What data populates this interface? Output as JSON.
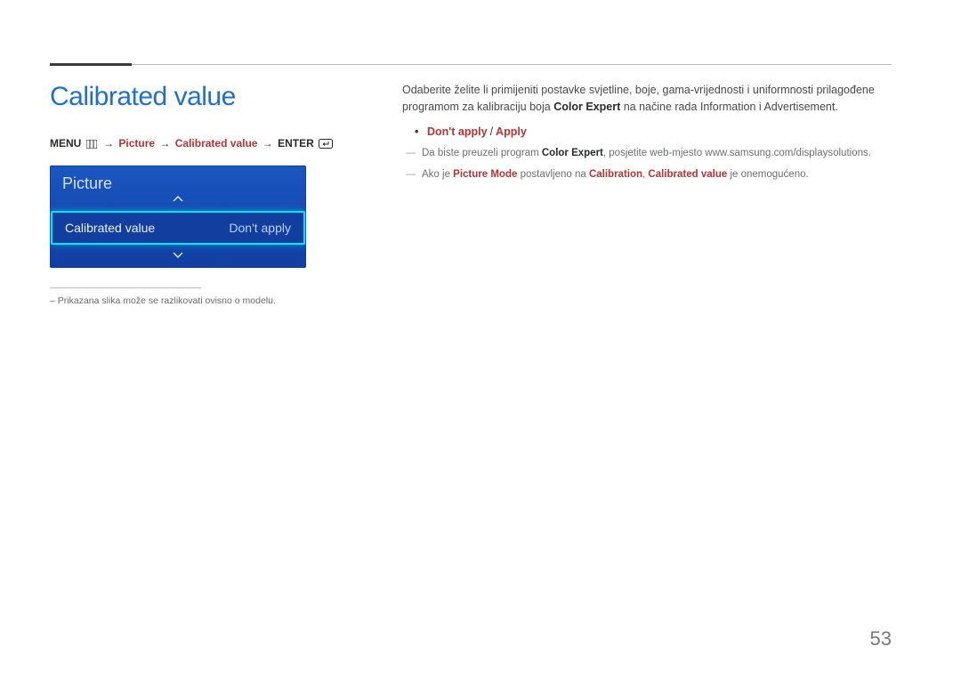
{
  "header": {
    "title": "Calibrated value"
  },
  "breadcrumb": {
    "menu": "MENU",
    "b1": "Picture",
    "b2": "Calibrated value",
    "enter": "ENTER"
  },
  "panel": {
    "title": "Picture",
    "row_label": "Calibrated value",
    "row_value": "Don't apply"
  },
  "left_footnote": "Prikazana slika može se razlikovati ovisno o modelu.",
  "body": {
    "intro_pre": "Odaberite želite li primijeniti postavke svjetline, boje, gama-vrijednosti i uniformnosti prilagođene programom za kalibraciju boja ",
    "intro_colorexpert": "Color Expert",
    "intro_post": " na načine rada Information i Advertisement.",
    "opt_dont": "Don't apply",
    "opt_apply": "Apply",
    "note1_pre": "Da biste preuzeli program ",
    "note1_ce": "Color Expert",
    "note1_post": ", posjetite web-mjesto www.samsung.com/displaysolutions.",
    "note2_pre": "Ako je ",
    "note2_pm": "Picture Mode",
    "note2_mid1": " postavljeno na ",
    "note2_cal": "Calibration",
    "note2_mid2": ", ",
    "note2_cv": "Calibrated value",
    "note2_post": " je onemogućeno."
  },
  "page_number": "53"
}
